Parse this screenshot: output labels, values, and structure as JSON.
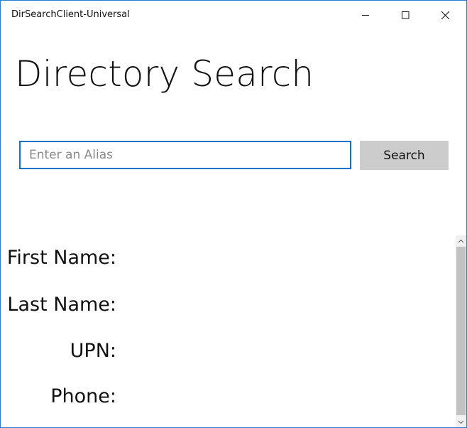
{
  "window": {
    "title": "DirSearchClient-Universal",
    "accent_color": "#0a73c7",
    "border_color": "#2b7bd1"
  },
  "caption_buttons": {
    "minimize_icon": "minimize-icon",
    "maximize_icon": "maximize-icon",
    "close_icon": "close-icon"
  },
  "main": {
    "page_title": "Directory Search",
    "search": {
      "placeholder": "Enter an Alias",
      "value": "",
      "button_label": "Search"
    },
    "fields": {
      "first_name_label": "First Name:",
      "last_name_label": "Last Name:",
      "upn_label": "UPN:",
      "phone_label": "Phone:"
    }
  },
  "scrollbar": {
    "up_icon": "chevron-up-icon",
    "down_icon": "chevron-down-icon"
  }
}
